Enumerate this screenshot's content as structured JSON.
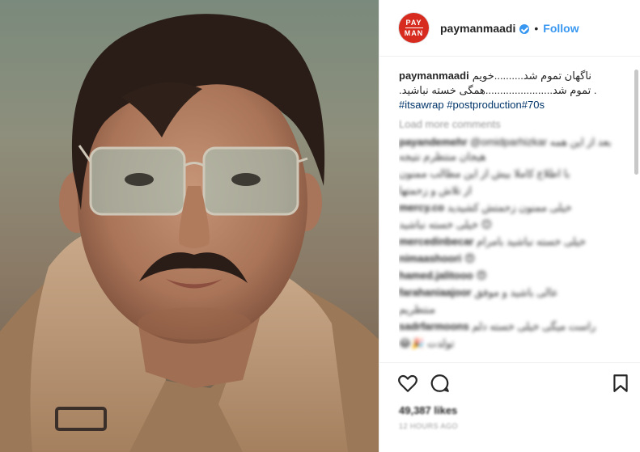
{
  "post": {
    "avatar_text_top": "PAY",
    "avatar_text_bottom": "MAN",
    "username": "paymanmaadi",
    "separator": "•",
    "follow_label": "Follow",
    "caption": {
      "username": "paymanmaadi",
      "line1": "ناگهان تموم شد..........خویم",
      "line2": ".تموم شد.......................همگی خسته نباشید .",
      "hashtags": "#itsawrap #postproduction#70s"
    },
    "load_more": "Load more comments",
    "blurred_comments": [
      {
        "user": "payandemehr",
        "text": "@omidparhizkar بعد از این همه هیجان منتظرم نتیجه"
      },
      {
        "user": "",
        "text": "با اطلاع کاملا بیش از این مطالب ممنون"
      },
      {
        "user": "",
        "text": "از تلاش و زحمتها"
      },
      {
        "user": "mercy.co",
        "text": "خیلی ممنون زحمتش کشیدید"
      },
      {
        "user": "",
        "text": "خیلی خسته نباشید 😊"
      },
      {
        "user": "mercedinbecar",
        "text": "خیلی خسته نباشید بامرام"
      },
      {
        "user": "nimaashoori",
        "text": "😍"
      },
      {
        "user": "hamed.jalitooo",
        "text": "😍"
      },
      {
        "user": "farahaniaajoor",
        "text": "عالی باشید و موفق"
      },
      {
        "user": "",
        "text": "منتظریم"
      },
      {
        "user": "sadrfarmoons",
        "text": "راست میگی خیلی خسته دلم"
      },
      {
        "user": "",
        "text": "😂🎉 تولدت"
      }
    ],
    "likes": "49,387 likes",
    "timestamp": "12 HOURS AGO"
  },
  "colors": {
    "accent": "#3897f0",
    "avatar_bg": "#d72b1f",
    "hashtag": "#003569"
  },
  "icons": [
    "heart-icon",
    "comment-icon",
    "bookmark-icon",
    "verified-badge-icon"
  ]
}
